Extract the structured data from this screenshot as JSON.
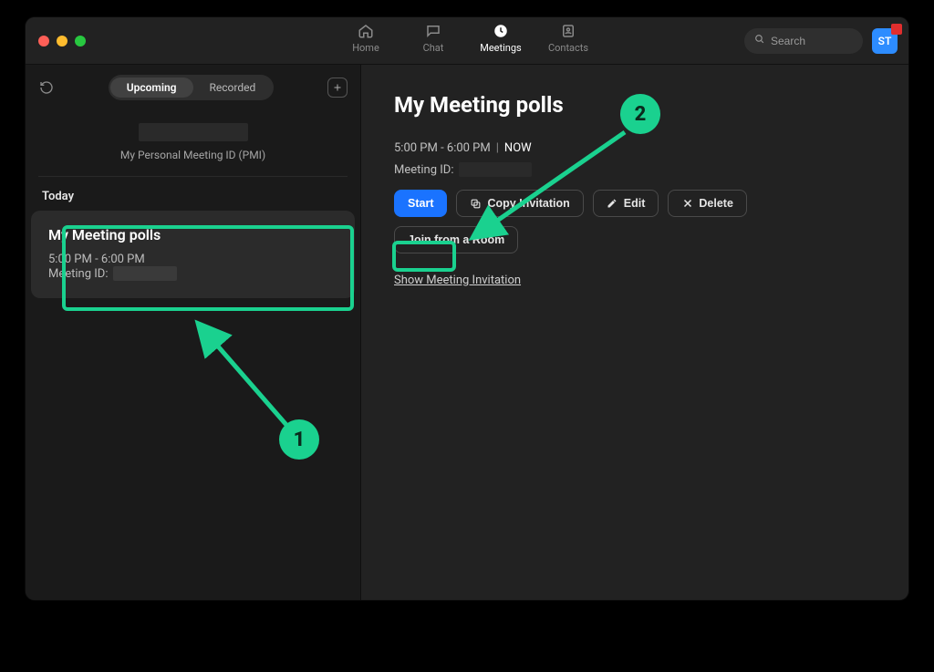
{
  "colors": {
    "accent_blue": "#1a73ff",
    "annotation_green": "#1ad18f"
  },
  "topnav": {
    "home": "Home",
    "chat": "Chat",
    "meetings": "Meetings",
    "contacts": "Contacts"
  },
  "search": {
    "placeholder": "Search"
  },
  "avatar": {
    "initials": "ST"
  },
  "sidebar": {
    "tabs": {
      "upcoming": "Upcoming",
      "recorded": "Recorded"
    },
    "pmi_label": "My Personal Meeting ID (PMI)",
    "today_label": "Today",
    "card": {
      "title": "My Meeting polls",
      "time": "5:00 PM - 6:00 PM",
      "meeting_id_label": "Meeting ID:"
    }
  },
  "main": {
    "title": "My Meeting polls",
    "time": "5:00 PM - 6:00 PM",
    "now": "NOW",
    "meeting_id_label": "Meeting ID:",
    "buttons": {
      "start": "Start",
      "copy_invitation": "Copy Invitation",
      "edit": "Edit",
      "delete": "Delete",
      "join_from_room": "Join from a Room"
    },
    "show_invitation": "Show Meeting Invitation"
  },
  "annotations": {
    "one": "1",
    "two": "2"
  }
}
